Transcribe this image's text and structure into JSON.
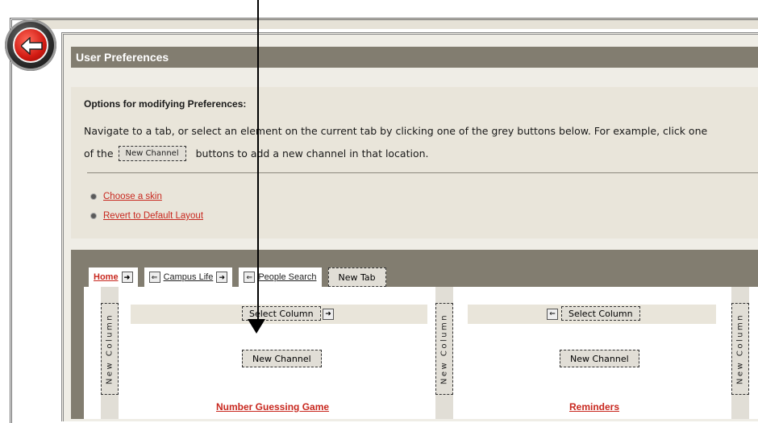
{
  "header": {
    "title": "User Preferences"
  },
  "options": {
    "title": "Options for modifying Preferences:",
    "instructions_line1": "Navigate to a tab, or select an element on the current tab by clicking one of the grey buttons below. For example, click one",
    "instructions_prefix": "of the",
    "instructions_button": "New Channel",
    "instructions_suffix": "buttons to add a new channel in that location.",
    "links": [
      {
        "label": "Choose a skin"
      },
      {
        "label": "Revert to Default Layout"
      }
    ]
  },
  "tabs": [
    {
      "label": "Home",
      "left_arrow": "",
      "right_arrow": "➜"
    },
    {
      "label": "Campus Life",
      "left_arrow": "⇐",
      "right_arrow": "➜"
    },
    {
      "label": "People Search",
      "left_arrow": "⇐",
      "right_arrow": ""
    }
  ],
  "new_tab_label": "New Tab",
  "new_column_label": "New Column",
  "columns": [
    {
      "select_label": "Select Column",
      "new_channel_label": "New Channel",
      "channel_title": "Number Guessing Game"
    },
    {
      "select_label": "Select Column",
      "new_channel_label": "New Channel",
      "channel_title": "Reminders"
    }
  ],
  "arrows": {
    "left": "⇐",
    "right": "➜"
  },
  "colors": {
    "title_bar": "#827d70",
    "panel_bg": "#e9e5da",
    "link": "#c8281f",
    "button_bg": "#e1ded6"
  }
}
